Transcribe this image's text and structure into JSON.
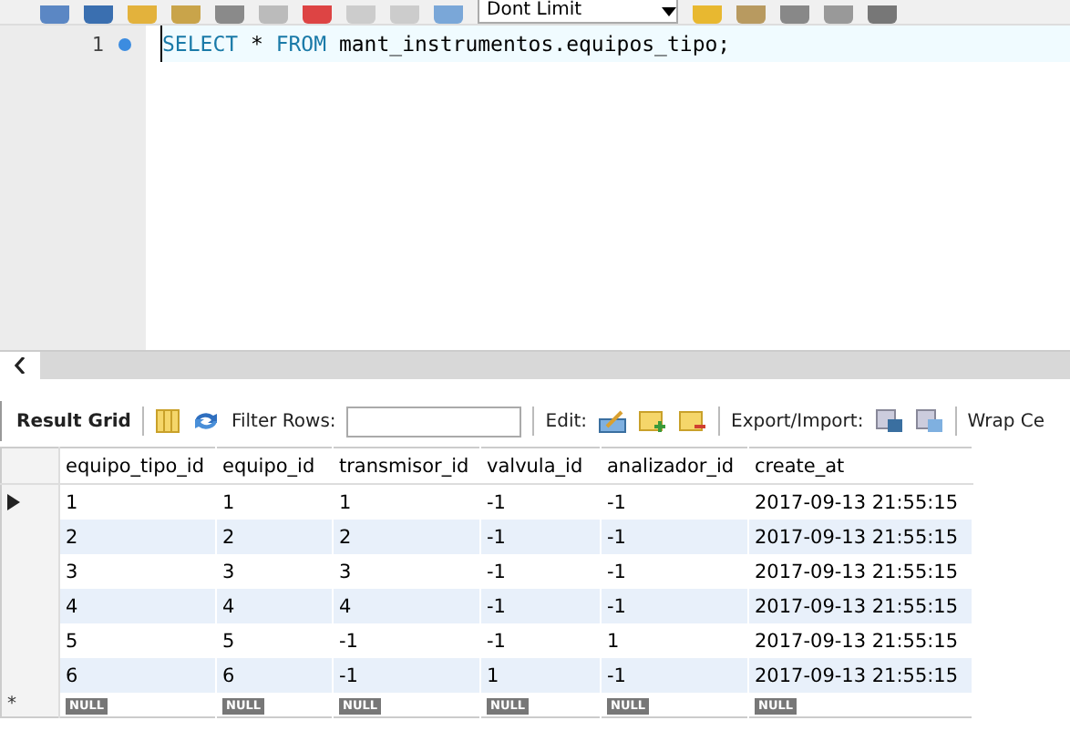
{
  "top_toolbar": {
    "limit_select": "Dont Limit"
  },
  "editor": {
    "lines": [
      {
        "number": "1",
        "sql": [
          {
            "kind": "keyword",
            "text": "SELECT"
          },
          {
            "kind": "plain",
            "text": " * "
          },
          {
            "kind": "keyword",
            "text": "FROM"
          },
          {
            "kind": "plain",
            "text": " mant_instrumentos.equipos_tipo;"
          }
        ]
      }
    ]
  },
  "result_toolbar": {
    "result_grid": "Result Grid",
    "filter_label": "Filter Rows:",
    "edit_label": "Edit:",
    "export_label": "Export/Import:",
    "wrap_label": "Wrap Ce"
  },
  "table": {
    "columns": [
      "equipo_tipo_id",
      "equipo_id",
      "transmisor_id",
      "valvula_id",
      "analizador_id",
      "create_at"
    ],
    "rows": [
      {
        "current": true,
        "cells": [
          "1",
          "1",
          "1",
          "-1",
          "-1",
          "2017-09-13 21:55:15"
        ]
      },
      {
        "current": false,
        "cells": [
          "2",
          "2",
          "2",
          "-1",
          "-1",
          "2017-09-13 21:55:15"
        ]
      },
      {
        "current": false,
        "cells": [
          "3",
          "3",
          "3",
          "-1",
          "-1",
          "2017-09-13 21:55:15"
        ]
      },
      {
        "current": false,
        "cells": [
          "4",
          "4",
          "4",
          "-1",
          "-1",
          "2017-09-13 21:55:15"
        ]
      },
      {
        "current": false,
        "cells": [
          "5",
          "5",
          "-1",
          "-1",
          "1",
          "2017-09-13 21:55:15"
        ]
      },
      {
        "current": false,
        "cells": [
          "6",
          "6",
          "-1",
          "1",
          "-1",
          "2017-09-13 21:55:15"
        ]
      }
    ],
    "new_row": {
      "marker": "*",
      "cells": [
        "NULL",
        "NULL",
        "NULL",
        "NULL",
        "NULL",
        "NULL"
      ]
    }
  }
}
